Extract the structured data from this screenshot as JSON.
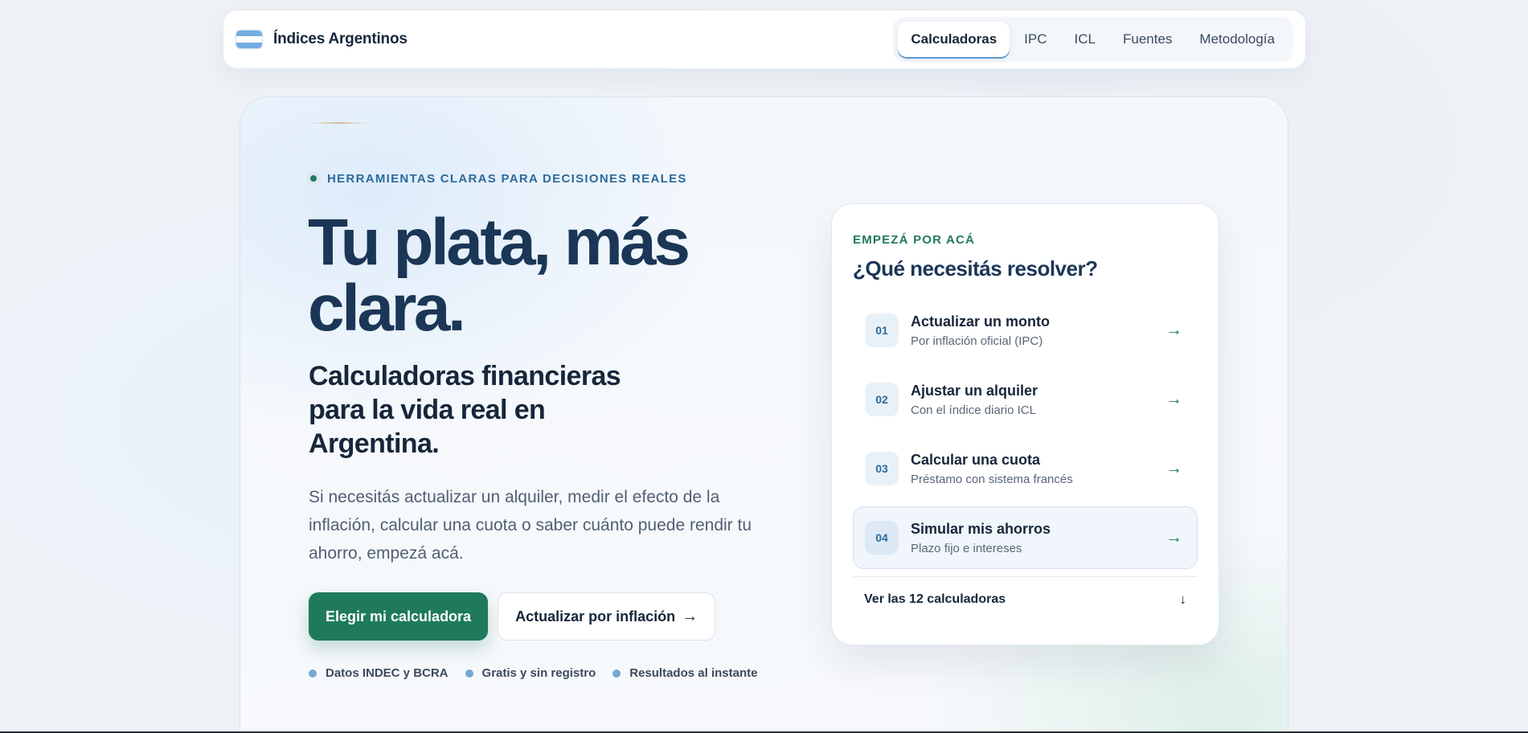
{
  "header": {
    "brand_name": "Índices Argentinos",
    "nav": [
      {
        "label": "Calculadoras",
        "active": true
      },
      {
        "label": "IPC",
        "active": false
      },
      {
        "label": "ICL",
        "active": false
      },
      {
        "label": "Fuentes",
        "active": false
      },
      {
        "label": "Metodología",
        "active": false
      }
    ]
  },
  "hero": {
    "eyebrow": "HERRAMIENTAS CLARAS PARA DECISIONES REALES",
    "title": "Tu plata, más clara.",
    "subtitle": "Calculadoras financieras para la vida real en Argentina.",
    "description": "Si necesitás actualizar un alquiler, medir el efecto de la inflación, calcular una cuota o saber cuánto puede rendir tu ahorro, empezá acá.",
    "primary_cta": "Elegir mi calculadora",
    "secondary_cta": "Actualizar por inflación",
    "secondary_cta_arrow": "→",
    "badges": [
      "Datos INDEC y BCRA",
      "Gratis y sin registro",
      "Resultados al instante"
    ]
  },
  "panel": {
    "eyebrow": "EMPEZÁ POR ACÁ",
    "title": "¿Qué necesitás resolver?",
    "options": [
      {
        "number": "01",
        "title": "Actualizar un monto",
        "description": "Por inflación oficial (IPC)",
        "arrow": "→"
      },
      {
        "number": "02",
        "title": "Ajustar un alquiler",
        "description": "Con el índice diario ICL",
        "arrow": "→"
      },
      {
        "number": "03",
        "title": "Calcular una cuota",
        "description": "Préstamo con sistema francés",
        "arrow": "→"
      },
      {
        "number": "04",
        "title": "Simular mis ahorros",
        "description": "Plazo fijo e intereses",
        "arrow": "→"
      }
    ],
    "footer_link": "Ver las 12 calculadoras",
    "footer_arrow": "↓"
  },
  "colors": {
    "brand_green": "#1f7a5c",
    "brand_navy": "#1b3656",
    "accent_blue": "#2b6a9b",
    "flag_blue": "#74acdf"
  },
  "icons": {
    "brand": "argentina-flag-icon",
    "option_arrow": "arrow-right-icon",
    "footer_arrow": "arrow-down-icon"
  }
}
